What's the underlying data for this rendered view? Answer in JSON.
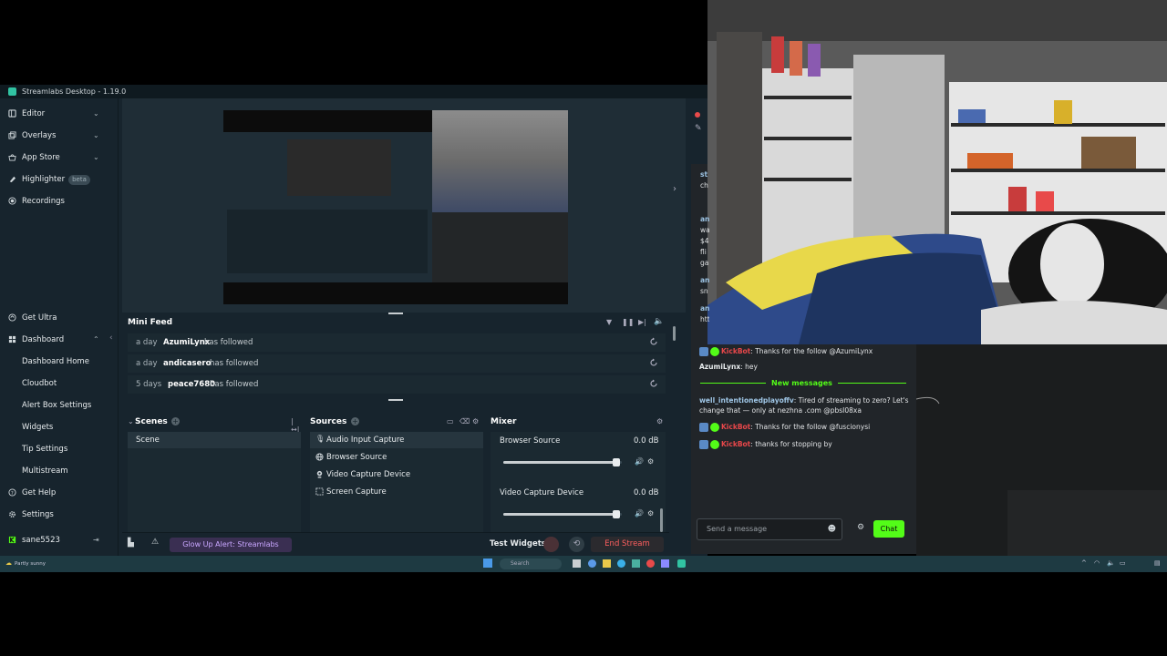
{
  "window": {
    "title": "Streamlabs Desktop - 1.19.0"
  },
  "sidebar": {
    "top_items": [
      {
        "label": "Editor",
        "icon": "layout-icon"
      },
      {
        "label": "Overlays",
        "icon": "overlay-icon"
      },
      {
        "label": "App Store",
        "icon": "store-icon"
      },
      {
        "label": "Highlighter",
        "icon": "highlighter-icon",
        "badge": "beta"
      },
      {
        "label": "Recordings",
        "icon": "record-icon"
      }
    ],
    "get_ultra": "Get Ultra",
    "dashboard": "Dashboard",
    "dashboard_subitems": [
      "Dashboard Home",
      "Cloudbot",
      "Alert Box Settings",
      "Widgets",
      "Tip Settings",
      "Multistream"
    ],
    "get_help": "Get Help",
    "settings": "Settings",
    "username": "sane5523"
  },
  "minifeed": {
    "title": "Mini Feed",
    "rows": [
      {
        "time": "a day",
        "name": "AzumiLynx",
        "action": "has followed"
      },
      {
        "time": "a day",
        "name": "andicasero",
        "action": "has followed"
      },
      {
        "time": "5 days",
        "name": "peace7680",
        "action": "has followed"
      }
    ]
  },
  "scenes": {
    "title": "Scenes",
    "items": [
      "Scene"
    ]
  },
  "sources": {
    "title": "Sources",
    "items": [
      "Audio Input Capture",
      "Browser Source",
      "Video Capture Device",
      "Screen Capture"
    ]
  },
  "mixer": {
    "title": "Mixer",
    "channels": [
      {
        "name": "Browser Source",
        "db": "0.0 dB",
        "level": 0.95
      },
      {
        "name": "Video Capture Device",
        "db": "0.0 dB",
        "level": 0.95
      }
    ]
  },
  "bottombar": {
    "promo": "Glow Up Alert: Streamlabs Mobile",
    "test_widgets": "Test Widgets",
    "end_stream": "End Stream"
  },
  "chat": {
    "lines": [
      {
        "type": "bot",
        "user": "KickBot",
        "text": ": Thanks for the follow @AzumiLynx"
      },
      {
        "type": "user",
        "user": "AzumiLynx",
        "text": ": hey"
      }
    ],
    "new_messages_label": "New messages",
    "new_lines": [
      {
        "type": "user",
        "user": "well_intentionedplayoffv",
        "text": ": Tired of streaming to zero? Let's change that — only at nezhna .com @pbsI08xa"
      },
      {
        "type": "bot",
        "user": "KickBot",
        "text": ": Thanks for the follow @fuscionysi"
      },
      {
        "type": "bot",
        "user": "KickBot",
        "text": ": thanks for stopping by"
      }
    ],
    "input_placeholder": "Send a message",
    "send_label": "Chat",
    "fragments": [
      "st",
      "ch",
      "an",
      "wa",
      "$4",
      "fli",
      "ga",
      "an",
      "sn",
      "an",
      "htt"
    ]
  },
  "taskbar": {
    "search_label": "Search",
    "weather": "Partly sunny"
  },
  "colors": {
    "accent": "#31c3a2",
    "kick_green": "#53fc18",
    "end_red": "#ff5f5f"
  }
}
